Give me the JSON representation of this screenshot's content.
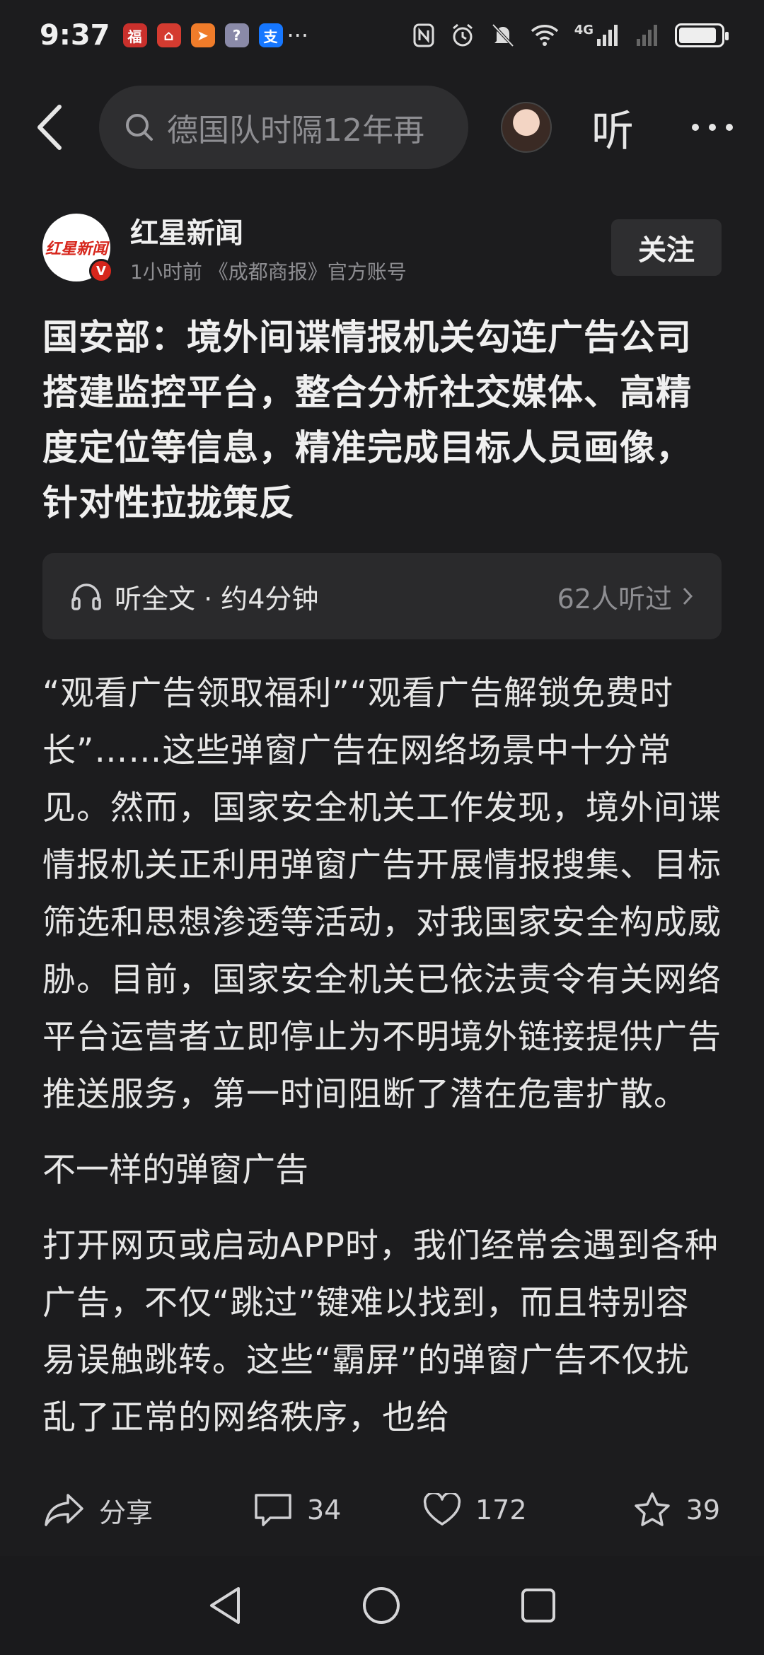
{
  "status_bar": {
    "time": "9:37",
    "notifications": [
      {
        "name": "app-red-icon",
        "glyph": "福",
        "color": "#c9302c"
      },
      {
        "name": "app-home-icon",
        "glyph": "⌂",
        "color": "#d43b30"
      },
      {
        "name": "app-send-icon",
        "glyph": "➤",
        "color": "#f07c2a"
      },
      {
        "name": "app-circle-icon",
        "glyph": "?",
        "color": "#8a8aa8"
      },
      {
        "name": "alipay-icon",
        "glyph": "支",
        "color": "#1677ff"
      }
    ],
    "more_dots": "···",
    "network": "4G"
  },
  "search": {
    "text": "德国队时隔12年再"
  },
  "header": {
    "listen_label": "听"
  },
  "author": {
    "logo_text": "红星新闻",
    "badge": "V",
    "name": "红星新闻",
    "meta": "1小时前  《成都商报》官方账号",
    "follow_label": "关注"
  },
  "article": {
    "title": "国安部：境外间谍情报机关勾连广告公司搭建监控平台，整合分析社交媒体、高精度定位等信息，精准完成目标人员画像，针对性拉拢策反",
    "listen_card": {
      "label": "听全文 · 约4分钟",
      "count": "62人听过"
    },
    "paragraph_1": "“观看广告领取福利”“观看广告解锁免费时长”……这些弹窗广告在网络场景中十分常见。然而，国家安全机关工作发现，境外间谍情报机关正利用弹窗广告开展情报搜集、目标筛选和思想渗透等活动，对我国家安全构成威胁。目前，国家安全机关已依法责令有关网络平台运营者立即停止为不明境外链接提供广告推送服务，第一时间阻断了潜在危害扩散。",
    "subheading": "不一样的弹窗广告",
    "paragraph_2": "打开网页或启动APP时，我们经常会遇到各种广告，不仅“跳过”键难以找到，而且特别容易误触跳转。这些“霸屏”的弹窗广告不仅扰乱了正常的网络秩序，也给"
  },
  "actions": {
    "share_label": "分享",
    "comment_count": "34",
    "like_count": "172",
    "favorite_count": "39"
  }
}
